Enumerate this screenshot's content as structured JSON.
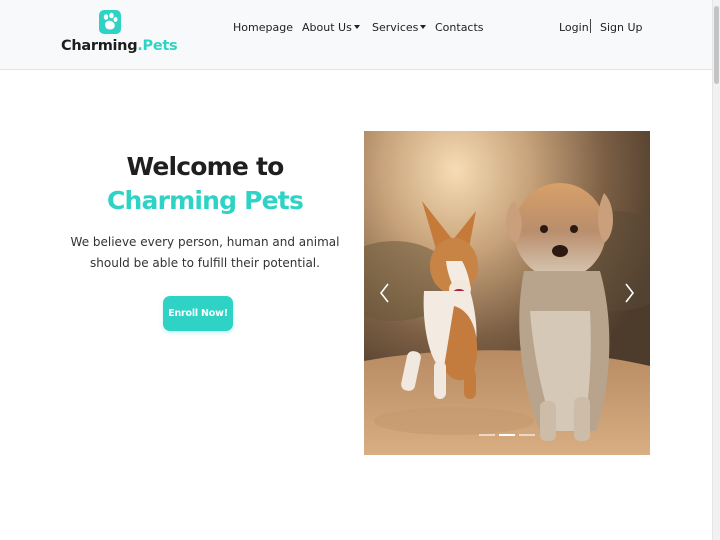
{
  "brand": {
    "name_main": "Charming",
    "name_accent": ".Pets",
    "accent_color": "#2ed3c5",
    "logo_icon": "paw-icon"
  },
  "nav": {
    "items": [
      {
        "label": "Homepage",
        "has_dropdown": false
      },
      {
        "label": "About Us",
        "has_dropdown": true
      },
      {
        "label": "Services",
        "has_dropdown": true
      },
      {
        "label": "Contacts",
        "has_dropdown": false
      }
    ]
  },
  "auth": {
    "login": "Login",
    "separator": "|",
    "signup": "Sign Up"
  },
  "hero": {
    "title_prefix": "Welcome to ",
    "title_accent": "Charming Pets",
    "subtitle": "We believe every person, human and animal should be able to fulfill their potential.",
    "cta_label": "Enroll Now!"
  },
  "carousel": {
    "image_subject": "corgi-and-terrier-photo",
    "prev_icon": "chevron-left-icon",
    "next_icon": "chevron-right-icon",
    "slide_count": 3,
    "active_slide": 2
  }
}
